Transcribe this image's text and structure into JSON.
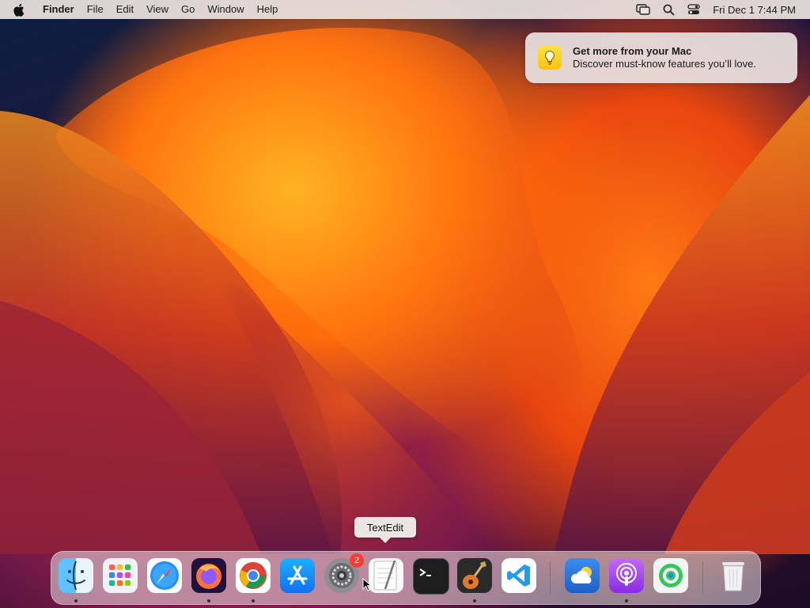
{
  "menubar": {
    "app_name": "Finder",
    "menus": [
      "File",
      "Edit",
      "View",
      "Go",
      "Window",
      "Help"
    ],
    "status_icons": [
      "screen-mirroring-icon",
      "spotlight-search-icon",
      "control-center-icon"
    ],
    "datetime": "Fri Dec 1  7:44 PM"
  },
  "notification": {
    "icon": "lightbulb-icon",
    "title": "Get more from your Mac",
    "body": "Discover must-know features you’ll love."
  },
  "tooltip": {
    "label": "TextEdit"
  },
  "dock": {
    "apps": [
      {
        "name": "Finder",
        "icon": "finder-icon",
        "running": true
      },
      {
        "name": "Launchpad",
        "icon": "launchpad-icon",
        "running": false
      },
      {
        "name": "Safari",
        "icon": "safari-icon",
        "running": false
      },
      {
        "name": "Firefox",
        "icon": "firefox-icon",
        "running": true
      },
      {
        "name": "Google Chrome",
        "icon": "chrome-icon",
        "running": true
      },
      {
        "name": "App Store",
        "icon": "app-store-icon",
        "running": false
      },
      {
        "name": "System Settings",
        "icon": "system-settings-icon",
        "running": false,
        "badge": "2"
      },
      {
        "name": "TextEdit",
        "icon": "textedit-icon",
        "running": false
      },
      {
        "name": "Terminal",
        "icon": "terminal-icon",
        "running": false
      },
      {
        "name": "GarageBand",
        "icon": "garageband-icon",
        "running": true
      },
      {
        "name": "Visual Studio Code",
        "icon": "vscode-icon",
        "running": false
      },
      {
        "name": "Weather",
        "icon": "weather-icon",
        "running": false
      },
      {
        "name": "Podcasts",
        "icon": "podcasts-icon",
        "running": true
      },
      {
        "name": "Find My",
        "icon": "find-my-icon",
        "running": false
      },
      {
        "name": "Trash",
        "icon": "trash-icon",
        "running": false
      }
    ]
  },
  "colors": {
    "wallpaper_orange": "#ff7a14",
    "wallpaper_navy": "#0c1f3f",
    "badge_red": "#ff3b30"
  }
}
